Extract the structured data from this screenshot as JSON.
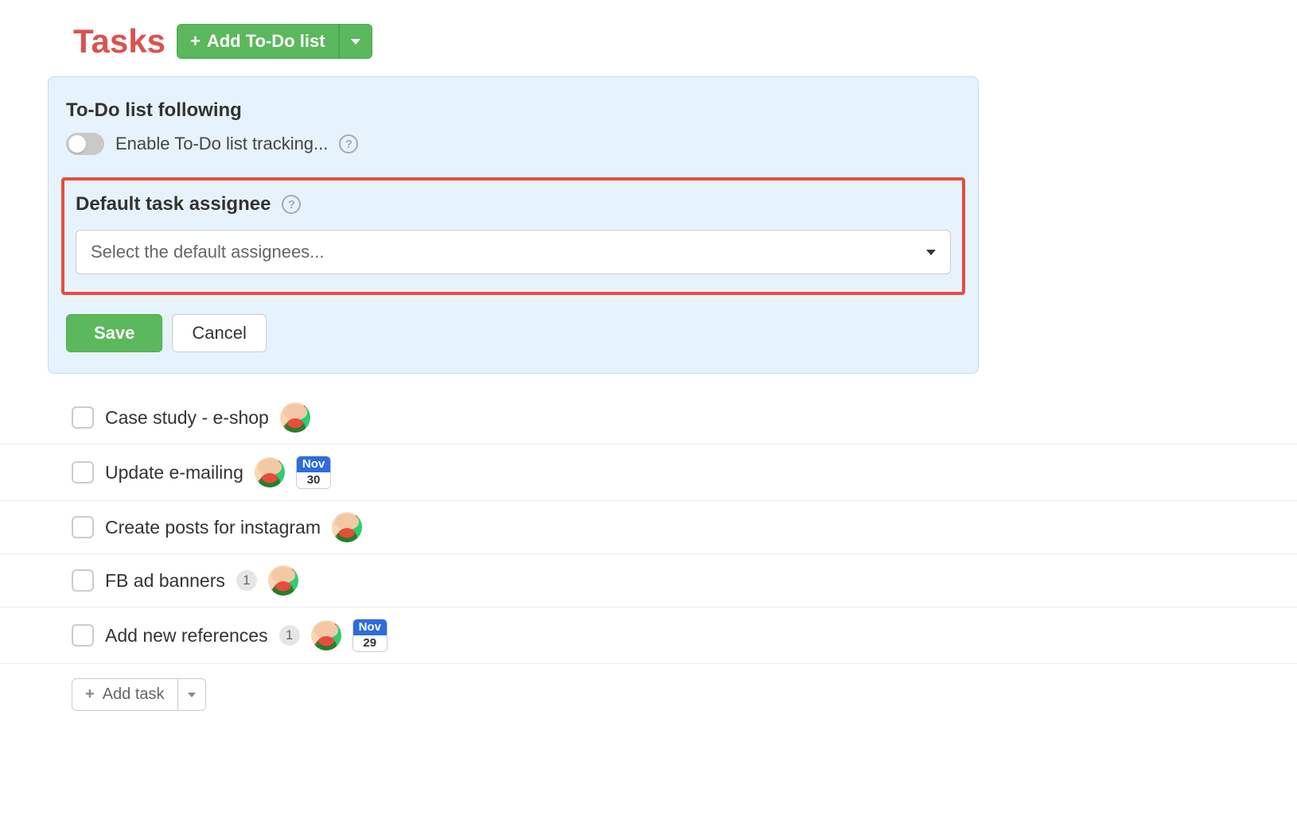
{
  "header": {
    "title": "Tasks",
    "add_list_label": "Add To-Do list"
  },
  "panel": {
    "following_title": "To-Do list following",
    "toggle_label": "Enable To-Do list tracking...",
    "assignee_title": "Default task assignee",
    "assignee_placeholder": "Select the default assignees...",
    "save_label": "Save",
    "cancel_label": "Cancel"
  },
  "tasks": [
    {
      "title": "Case study - e-shop",
      "count": null,
      "date": null
    },
    {
      "title": "Update e-mailing",
      "count": null,
      "date": {
        "month": "Nov",
        "day": "30"
      }
    },
    {
      "title": "Create posts for instagram",
      "count": null,
      "date": null
    },
    {
      "title": "FB ad banners",
      "count": "1",
      "date": null
    },
    {
      "title": "Add new references",
      "count": "1",
      "date": {
        "month": "Nov",
        "day": "29"
      }
    }
  ],
  "add_task_label": "Add task"
}
